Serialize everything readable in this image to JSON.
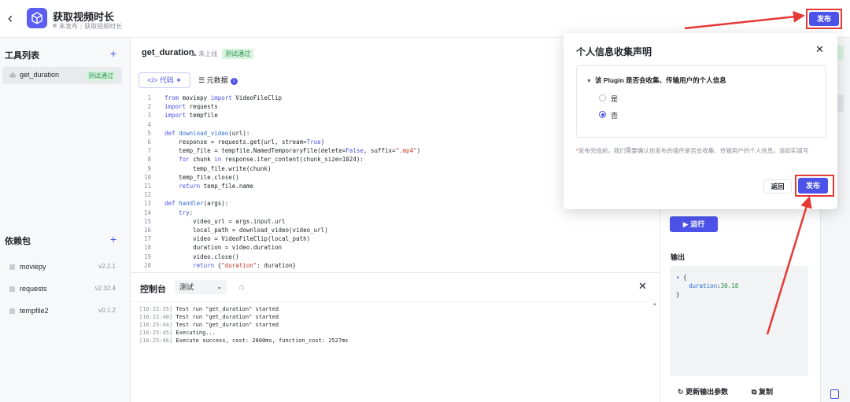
{
  "header": {
    "title": "获取视频时长",
    "status": "未发布",
    "subtitle": "获取视频时长",
    "publish_label": "发布"
  },
  "sidebar": {
    "tools_title": "工具列表",
    "tool": {
      "name": "get_duration",
      "badge": "测试通过"
    },
    "deps_title": "依赖包",
    "deps": [
      {
        "name": "moviepy",
        "version": "v2.2.1"
      },
      {
        "name": "requests",
        "version": "v2.32.4"
      },
      {
        "name": "tempfile2",
        "version": "v0.1.2"
      }
    ]
  },
  "editor": {
    "tool_name": "get_duration",
    "online_status": "未上线",
    "test_badge": "测试通过",
    "tab_code": "代码",
    "tab_meta": "元数据",
    "lines": [
      "from moviepy import VideoFileClip",
      "import requests",
      "import tempfile",
      "",
      "def download_video(url):",
      "    response = requests.get(url, stream=True)",
      "    temp_file = tempfile.NamedTemporaryFile(delete=False, suffix=\".mp4\")",
      "    for chunk in response.iter_content(chunk_size=1024):",
      "        temp_file.write(chunk)",
      "    temp_file.close()",
      "    return temp_file.name",
      "",
      "def handler(args):",
      "    try:",
      "        video_url = args.input.url",
      "        local_path = download_video(video_url)",
      "        video = VideoFileClip(local_path)",
      "        duration = video.duration",
      "        video.close()",
      "        return {\"duration\": duration}"
    ]
  },
  "console": {
    "title": "控制台",
    "select_value": "测试",
    "logs": [
      {
        "time": "[16:22:35]",
        "text": "Test run \"get_duration\" started"
      },
      {
        "time": "[16:22:40]",
        "text": "Test run \"get_duration\" started"
      },
      {
        "time": "[16:25:44]",
        "text": "Test run \"get_duration\" started"
      },
      {
        "time": "[16:25:45]",
        "text": "Executing..."
      },
      {
        "time": "[16:25:46]",
        "text": "Execute success, cost: 2800ms, function_cost: 2527ms"
      }
    ]
  },
  "right": {
    "run_label": "运行",
    "output_label": "输出",
    "output": {
      "open": "{",
      "key": "duration",
      "value": "30.18",
      "close": "}"
    },
    "refresh_label": "更新输出参数",
    "copy_label": "复制"
  },
  "modal": {
    "title": "个人信息收集声明",
    "question": "该 Plugin 是否会收集、传输用户的个人信息",
    "option_yes": "是",
    "option_no": "否",
    "selected": "否",
    "note": "发布完成前，我们需要确认你发布的插件是否会收集、传输用户的个人信息，请如实填写",
    "back_label": "返回",
    "publish_label": "发布"
  },
  "colors": {
    "accent": "#4d53e8",
    "highlight": "#e53935",
    "success": "#25914a"
  }
}
